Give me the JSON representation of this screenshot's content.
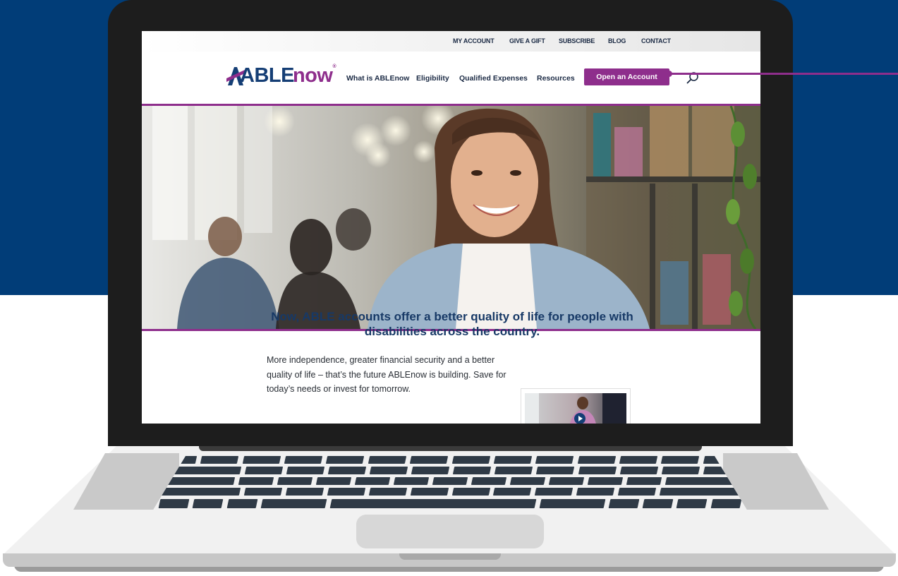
{
  "utility_nav": {
    "items": [
      {
        "label": "MY ACCOUNT"
      },
      {
        "label": "GIVE A GIFT"
      },
      {
        "label": "SUBSCRIBE"
      },
      {
        "label": "BLOG"
      },
      {
        "label": "CONTACT"
      }
    ]
  },
  "brand": {
    "logo_able": "ABLE",
    "logo_now": "now",
    "logo_reg": "®",
    "primary_color": "#153e75",
    "accent_color": "#8e2e8c"
  },
  "main_nav": {
    "items": [
      {
        "label": "What is ABLEnow"
      },
      {
        "label": "Eligibility"
      },
      {
        "label": "Qualified Expenses"
      },
      {
        "label": "Resources"
      }
    ],
    "cta_label": "Open an Account",
    "search_icon": "search-icon"
  },
  "content": {
    "headline": "Now, ABLE accounts offer a better quality of life for people with disabilities across the country.",
    "body": "More independence, greater financial security and a better quality of life – that’s the future ABLEnow is building. Save for today’s needs or invest for tomorrow.",
    "video_icon": "play-icon"
  },
  "colors": {
    "background_band": "#013d78",
    "laptop_bezel": "#1d1d1d"
  }
}
